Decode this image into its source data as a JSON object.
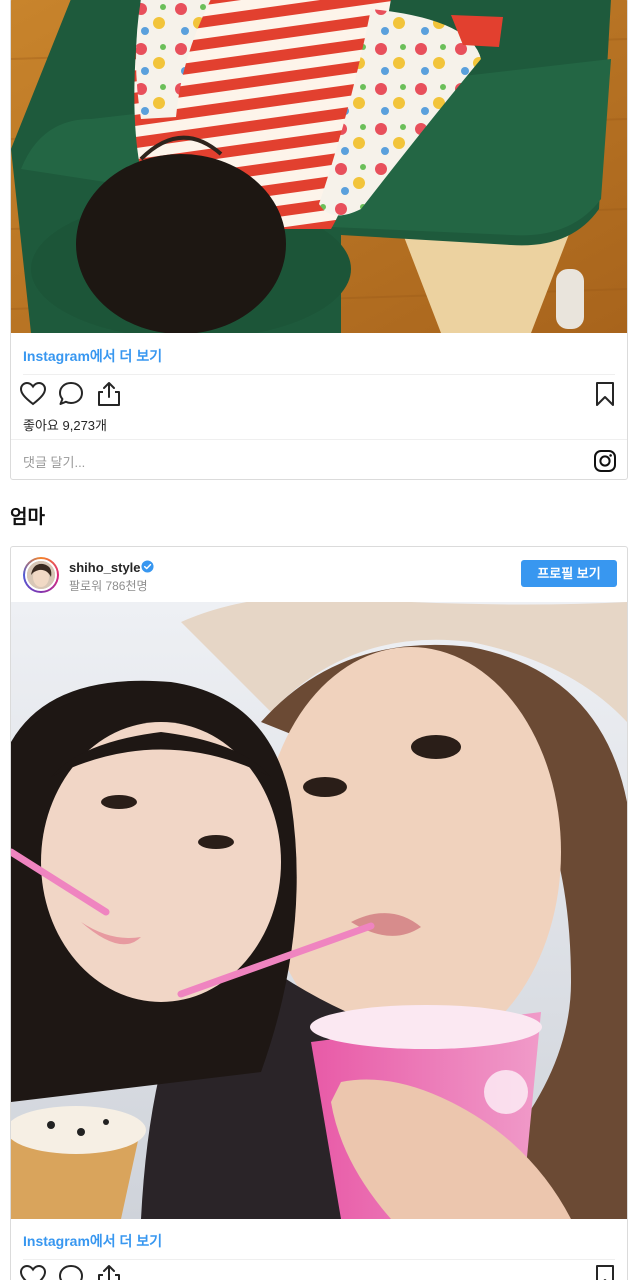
{
  "post1": {
    "view_more": "Instagram에서 더 보기",
    "likes": "좋아요 9,273개",
    "comment_placeholder": "댓글 달기..."
  },
  "section_heading": "엄마",
  "post2": {
    "username": "shiho_style",
    "followers": "팔로워 786천명",
    "profile_button": "프로필 보기",
    "view_more": "Instagram에서 더 보기"
  },
  "icons": [
    "heart-icon",
    "comment-icon",
    "share-icon",
    "bookmark-icon",
    "instagram-logo-icon",
    "verified-badge-icon"
  ],
  "colors": {
    "accent": "#3897f0",
    "text": "#262626",
    "muted": "#8e8e8e",
    "border": "#dbdbdb"
  }
}
